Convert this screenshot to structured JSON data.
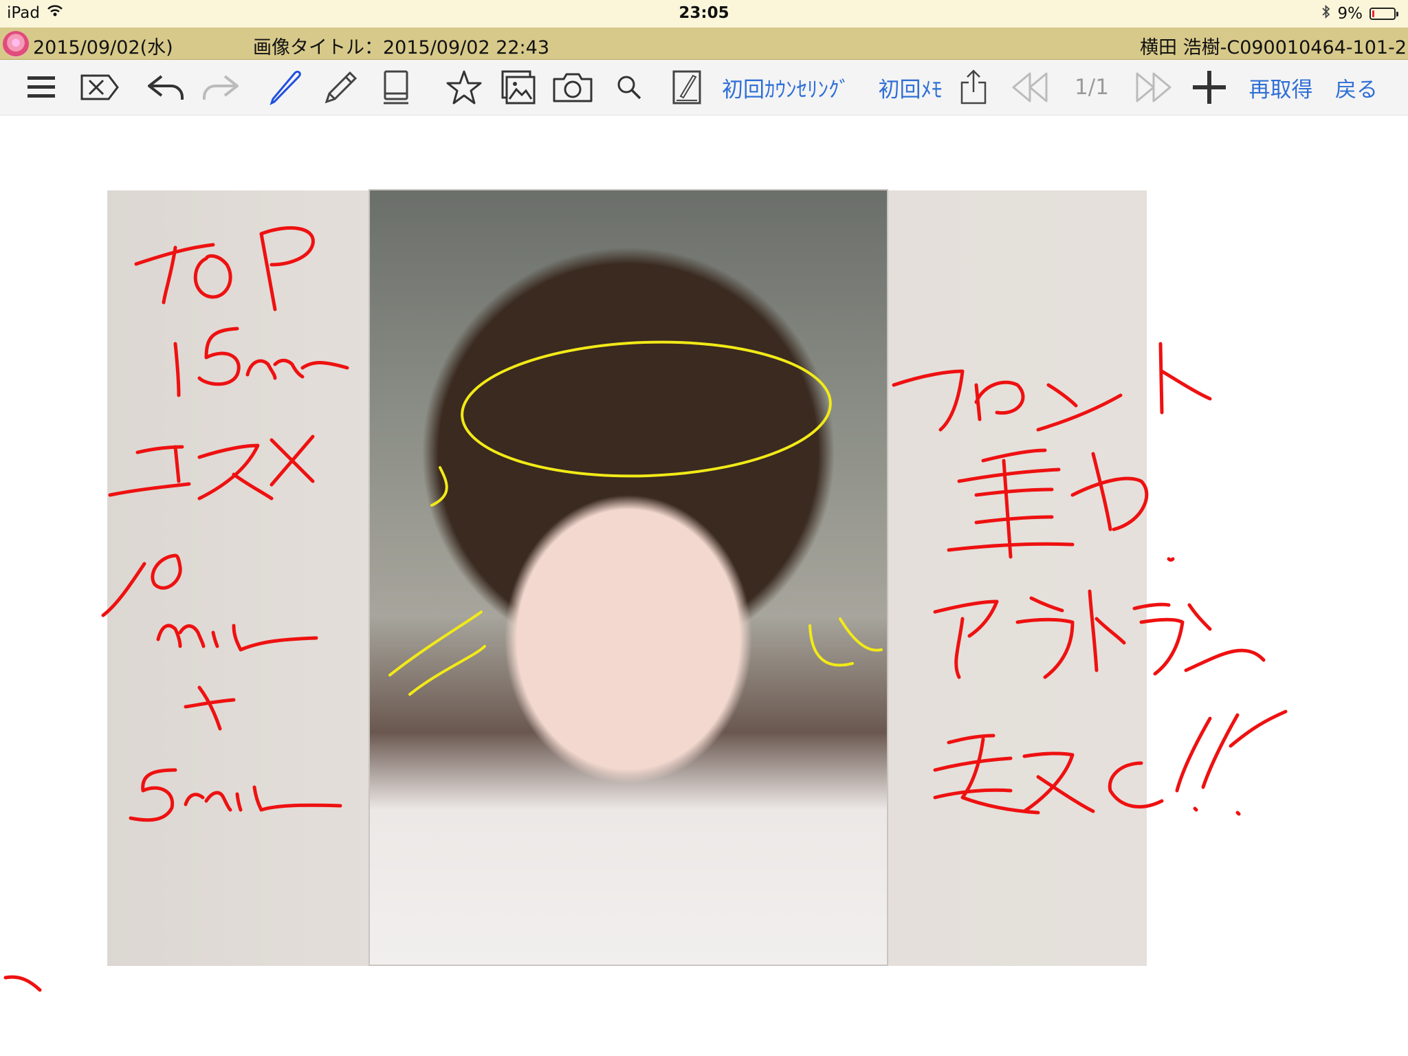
{
  "status_bar": {
    "device": "iPad",
    "time": "23:05",
    "battery": "9%",
    "battery_level_percent": 9,
    "icons": [
      "wifi-icon",
      "bluetooth-icon",
      "battery-icon"
    ]
  },
  "header": {
    "date": "2015/09/02(水)",
    "image_title": "画像タイトル：2015/09/02 22:43",
    "customer": "横田 浩樹-C090010464-101-2"
  },
  "toolbar": {
    "tools": [
      "menu-icon",
      "delete-icon",
      "undo-icon",
      "redo-icon",
      "pen-icon",
      "pencil-icon",
      "eraser-icon",
      "star-icon",
      "gallery-icon",
      "camera-icon",
      "search-icon",
      "note-icon"
    ],
    "initial_counseling": "初回ｶｳﾝｾﾘﾝｸﾞ",
    "initial_memo": "初回ﾒﾓ",
    "page_indicator": "1/1",
    "reacquire": "再取得",
    "back": "戻る"
  },
  "colors": {
    "status_bg": "#fbf6da",
    "header_bg": "#d7c98a",
    "toolbar_bg": "#f4f4f4",
    "link_blue": "#2f6fd6",
    "pen_blue": "#1f4fe0",
    "ink_red": "#ee1111",
    "ink_yellow": "#f2ea17"
  }
}
